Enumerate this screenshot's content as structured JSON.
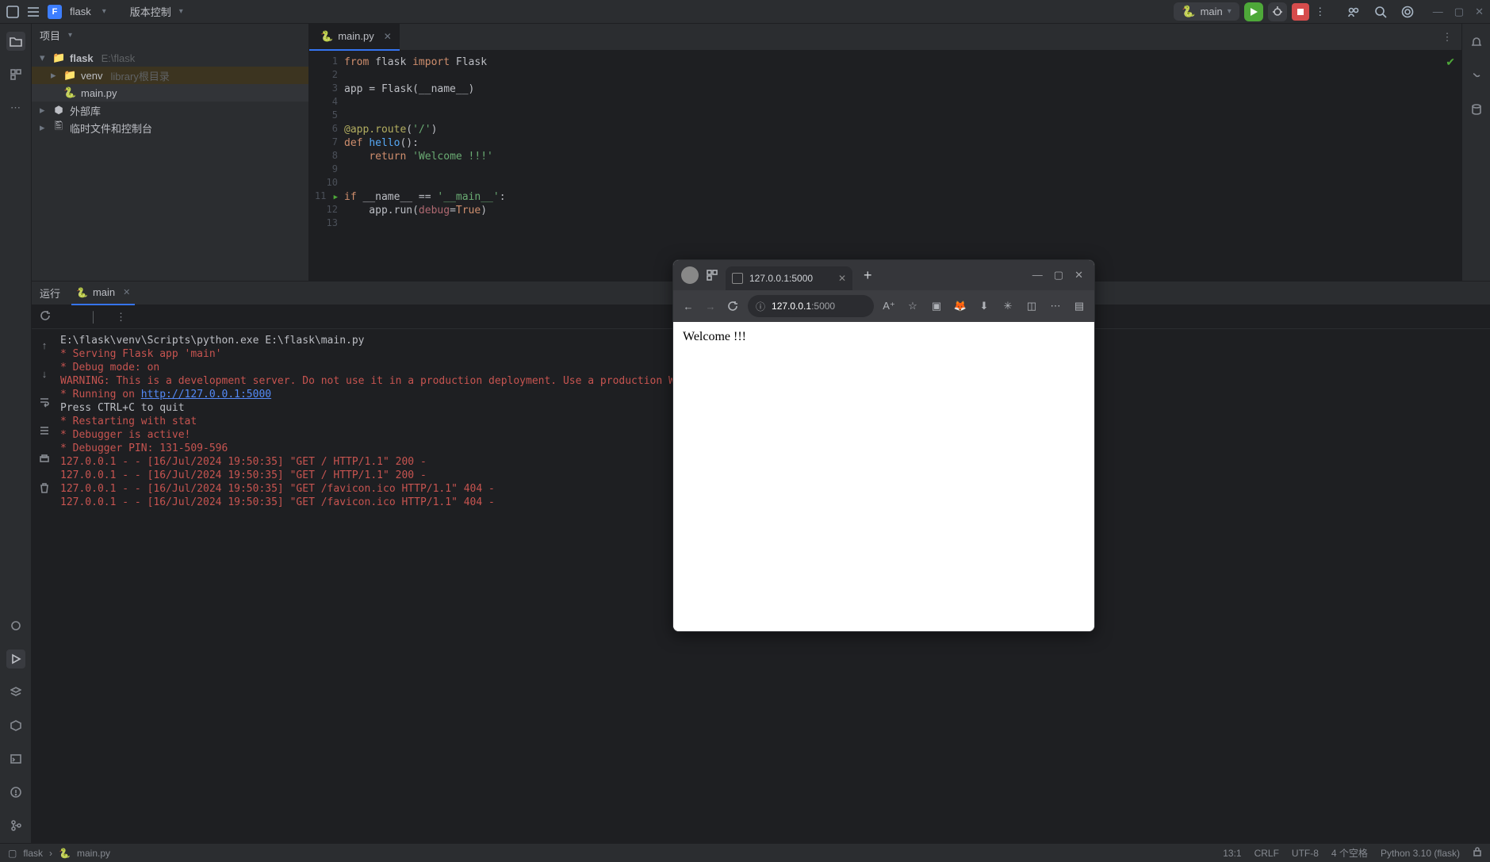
{
  "titlebar": {
    "project_letter": "F",
    "project_name": "flask",
    "menu_vcs": "版本控制",
    "run_config": "main"
  },
  "project_pane": {
    "title": "项目",
    "root_name": "flask",
    "root_path": "E:\\flask",
    "venv_name": "venv",
    "venv_hint": "library根目录",
    "main_py": "main.py",
    "ext_libs": "外部库",
    "scratch": "临时文件和控制台"
  },
  "editor": {
    "tab_name": "main.py",
    "lines": {
      "l1a": "from",
      "l1b": " flask ",
      "l1c": "import",
      "l1d": " Flask",
      "l3a": "app = Flask(",
      "l3b": "__name__",
      "l3c": ")",
      "l6a": "@app.route",
      "l6b": "(",
      "l6c": "'/'",
      "l6d": ")",
      "l7a": "def ",
      "l7b": "hello",
      "l7c": "():",
      "l8a": "    ",
      "l8b": "return ",
      "l8c": "'Welcome !!!'",
      "l11a": "if ",
      "l11b": "__name__",
      "l11c": " == ",
      "l11d": "'__main__'",
      "l11e": ":",
      "l12a": "    app.run(",
      "l12b": "debug",
      "l12c": "=",
      "l12d": "True",
      "l12e": ")"
    },
    "gutter": [
      "1",
      "2",
      "3",
      "4",
      "5",
      "6",
      "7",
      "8",
      "9",
      "10",
      "11",
      "12",
      "13"
    ]
  },
  "run_pane": {
    "title": "运行",
    "tab_name": "main",
    "lines": [
      {
        "cls": "c-plain",
        "txt": "E:\\flask\\venv\\Scripts\\python.exe E:\\flask\\main.py"
      },
      {
        "cls": "c-red",
        "txt": " * Serving Flask app 'main'"
      },
      {
        "cls": "c-red",
        "txt": " * Debug mode: on"
      },
      {
        "cls": "c-red",
        "txt": "WARNING: This is a development server. Do not use it in a production deployment. Use a production WSGI server instead."
      },
      {
        "cls": "",
        "txt": ""
      },
      {
        "cls": "c-plain",
        "txt": "Press CTRL+C to quit"
      },
      {
        "cls": "c-red",
        "txt": " * Restarting with stat"
      },
      {
        "cls": "c-red",
        "txt": " * Debugger is active!"
      },
      {
        "cls": "c-red",
        "txt": " * Debugger PIN: 131-509-596"
      },
      {
        "cls": "c-red",
        "txt": "127.0.0.1 - - [16/Jul/2024 19:50:35] \"GET / HTTP/1.1\" 200 -"
      },
      {
        "cls": "c-red",
        "txt": "127.0.0.1 - - [16/Jul/2024 19:50:35] \"GET / HTTP/1.1\" 200 -"
      },
      {
        "cls": "c-red",
        "txt": "127.0.0.1 - - [16/Jul/2024 19:50:35] \"GET /favicon.ico HTTP/1.1\" 404 -"
      },
      {
        "cls": "c-red",
        "txt": "127.0.0.1 - - [16/Jul/2024 19:50:35] \"GET /favicon.ico HTTP/1.1\" 404 -"
      }
    ],
    "running_on_prefix": " * Running on ",
    "running_on_link": "http://127.0.0.1:5000"
  },
  "statusbar": {
    "breadcrumb_root": "flask",
    "breadcrumb_file": "main.py",
    "position": "13:1",
    "line_sep": "CRLF",
    "encoding": "UTF-8",
    "indent": "4 个空格",
    "interpreter": "Python 3.10 (flask)"
  },
  "browser": {
    "tab_title": "127.0.0.1:5000",
    "addr_host": "127.0.0.1",
    "addr_port": ":5000",
    "body_text": "Welcome !!!"
  }
}
